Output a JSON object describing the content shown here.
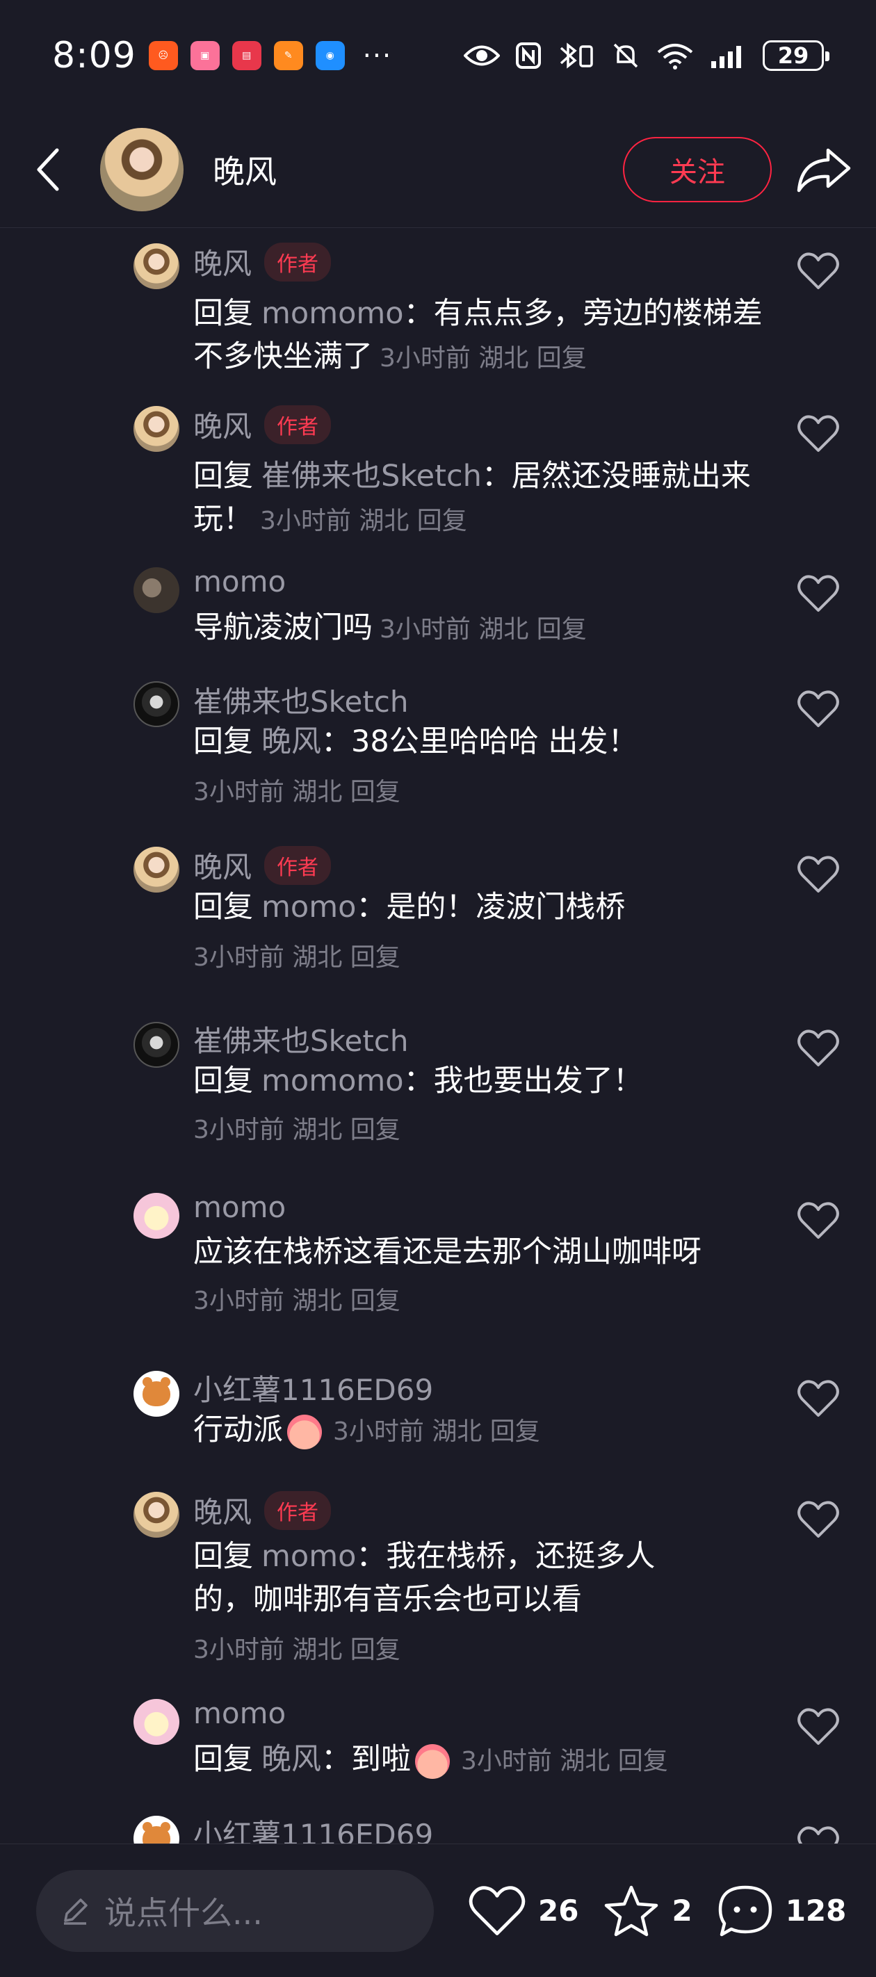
{
  "status_bar": {
    "time": "8:09",
    "battery": "29",
    "dots": "···"
  },
  "header": {
    "author_name": "晚风",
    "follow_label": "关注"
  },
  "comments": [
    {
      "name": "晚风",
      "tag": "作者",
      "reply_word": "回复",
      "reply_target": "momomo",
      "text": "：有点点多，旁边的楼梯差不多快坐满了",
      "meta": "3小时前 湖北 回复"
    },
    {
      "name": "晚风",
      "tag": "作者",
      "reply_word": "回复",
      "reply_target": "崔佛来也Sketch",
      "text": "：居然还没睡就出来玩！",
      "meta": "3小时前 湖北 回复"
    },
    {
      "name": "momo",
      "text": "导航凌波门吗",
      "meta": "3小时前 湖北 回复"
    },
    {
      "name": "崔佛来也Sketch",
      "reply_word": "回复",
      "reply_target": "晚风",
      "text": "：38公里哈哈哈  出发！",
      "meta": "3小时前 湖北 回复"
    },
    {
      "name": "晚风",
      "tag": "作者",
      "reply_word": "回复",
      "reply_target": "momo",
      "text": "：是的！凌波门栈桥",
      "meta": "3小时前 湖北 回复"
    },
    {
      "name": "崔佛来也Sketch",
      "reply_word": "回复",
      "reply_target": "momomo",
      "text": "：我也要出发了！",
      "meta": "3小时前 湖北 回复"
    },
    {
      "name": "momo",
      "text": "应该在栈桥这看还是去那个湖山咖啡呀",
      "meta": "3小时前 湖北 回复"
    },
    {
      "name": "小红薯1116ED69",
      "text": "行动派",
      "meta": "3小时前 湖北 回复"
    },
    {
      "name": "晚风",
      "tag": "作者",
      "reply_word": "回复",
      "reply_target": "momo",
      "text": "：我在栈桥，还挺多人的，咖啡那有音乐会也可以看",
      "meta": "3小时前 湖北 回复"
    },
    {
      "name": "momo",
      "reply_word": "回复",
      "reply_target": "晚风",
      "text": "：到啦",
      "meta": "3小时前 湖北 回复"
    },
    {
      "name": "小红薯1116ED69"
    }
  ],
  "bottom_bar": {
    "input_placeholder": "说点什么...",
    "likes": "26",
    "stars": "2",
    "comments": "128"
  }
}
